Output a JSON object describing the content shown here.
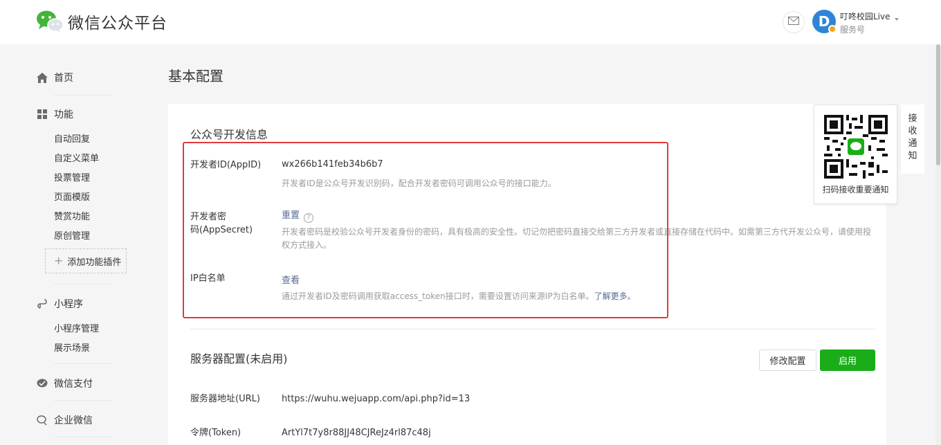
{
  "header": {
    "app_title": "微信公众平台",
    "account_name": "叮咚校园Live",
    "account_type": "服务号",
    "avatar_letter": "D"
  },
  "sidebar": {
    "home": "首页",
    "features": {
      "label": "功能",
      "items": [
        "自动回复",
        "自定义菜单",
        "投票管理",
        "页面模版",
        "赞赏功能",
        "原创管理"
      ]
    },
    "add_plugin": "添加功能插件",
    "miniprogram": {
      "label": "小程序",
      "items": [
        "小程序管理",
        "展示场景"
      ]
    },
    "pay": "微信支付",
    "work_wechat": "企业微信"
  },
  "main": {
    "page_title": "基本配置",
    "dev_info": {
      "title": "公众号开发信息",
      "appid_label": "开发者ID(AppID)",
      "appid_value": "wx266b141feb34b6b7",
      "appid_desc": "开发者ID是公众号开发识别码，配合开发者密码可调用公众号的接口能力。",
      "secret_label_line1": "开发者密",
      "secret_label_line2": "码(AppSecret)",
      "secret_action": "重置",
      "secret_help": "?",
      "secret_desc_line1": "开发者密码是校验公众号开发者身份的密码，具有极高的安全性。切记勿把密码直接交给第三方开发者或直接存储在代码中。如需第三方代开发公众号，请使用授",
      "secret_desc_line2": "权方式接入。",
      "ip_label": "IP白名单",
      "ip_action": "查看",
      "ip_desc": "通过开发者ID及密码调用获取access_token接口时，需要设置访问来源IP为白名单。",
      "ip_more": "了解更多。"
    },
    "server_config": {
      "title": "服务器配置(未启用)",
      "modify_button": "修改配置",
      "enable_button": "启用",
      "url_label": "服务器地址(URL)",
      "url_value": "https://wuhu.wejuapp.com/api.php?id=13",
      "token_label": "令牌(Token)",
      "token_value": "ArtYl7t7y8r88JJ48CJReJz4rl87c48j"
    }
  },
  "qr_float": {
    "caption": "扫码接收重要通知",
    "tab_chars": [
      "接",
      "收",
      "通",
      "知"
    ]
  },
  "colors": {
    "brand_green": "#1aad19",
    "link_blue": "#576b95",
    "highlight_red": "#e03a3a",
    "avatar_blue": "#2f84d8"
  }
}
